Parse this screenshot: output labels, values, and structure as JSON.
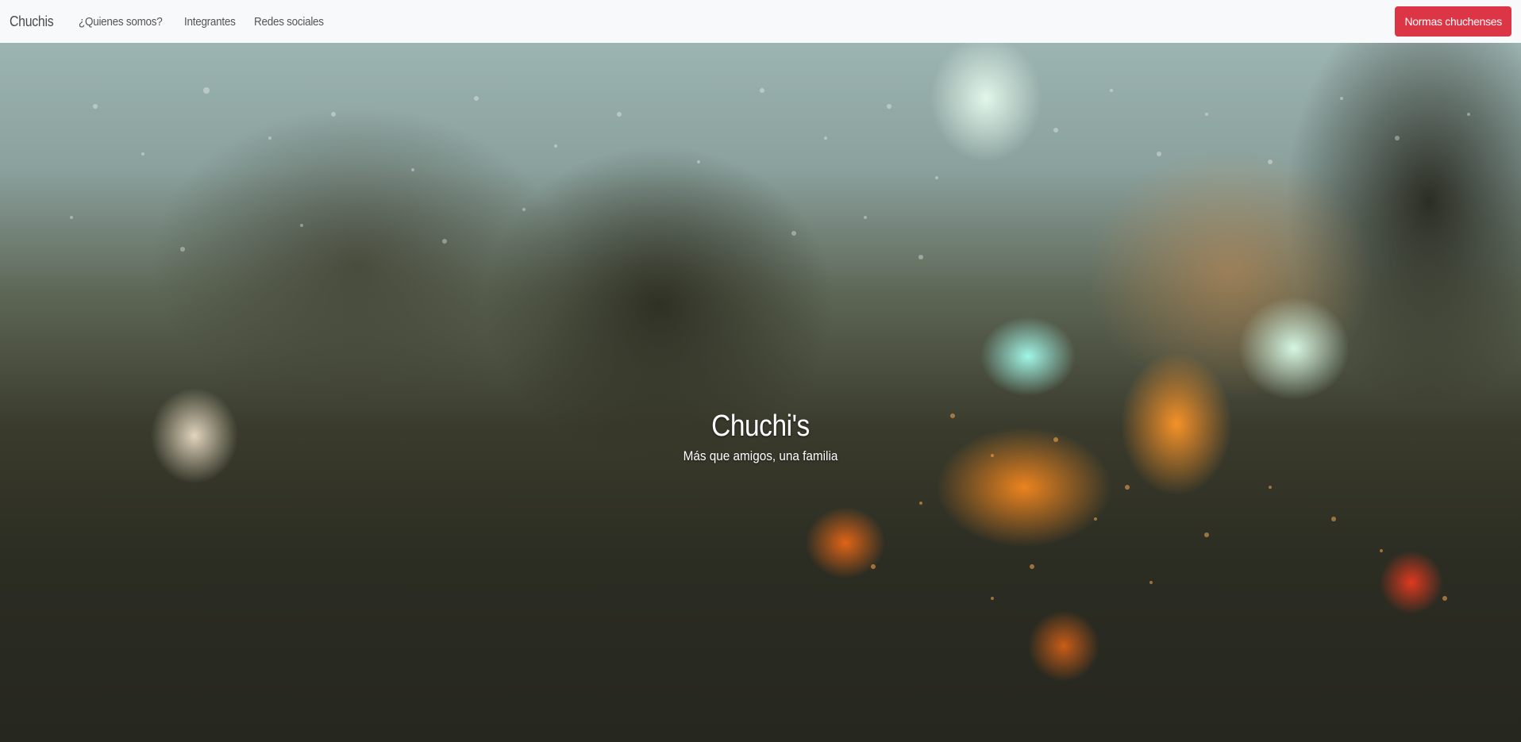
{
  "navbar": {
    "brand": "Chuchis",
    "links": [
      {
        "label": "¿Quienes somos?"
      },
      {
        "label": "Integrantes"
      },
      {
        "label": "Redes sociales"
      }
    ],
    "cta_label": "Normas chuchenses"
  },
  "hero": {
    "title": "Chuchi's",
    "subtitle": "Más que amigos, una familia"
  },
  "colors": {
    "navbar_bg": "#f8f9fa",
    "cta_bg": "#dc3545",
    "hero_text": "#ffffff"
  }
}
